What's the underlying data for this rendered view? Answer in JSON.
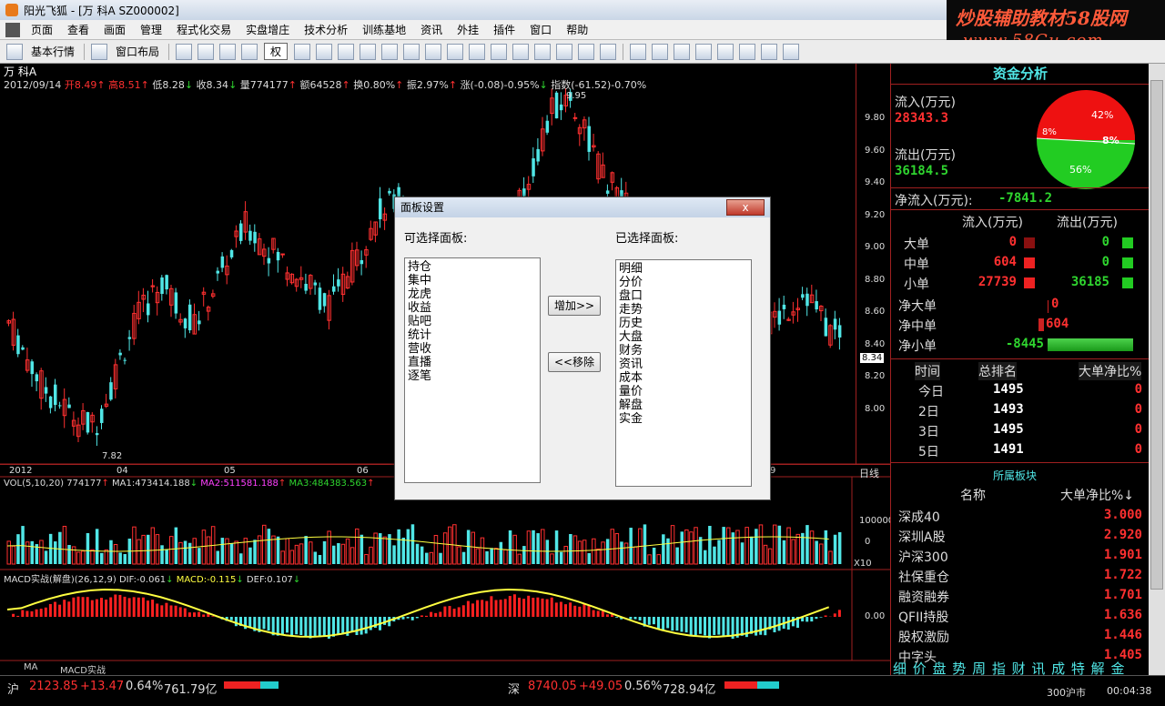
{
  "window": {
    "title": "阳光飞狐 - [万  科A  SZ000002]"
  },
  "watermark": {
    "line1": "炒股辅助教材58股网",
    "line2": "www.58Gu.com"
  },
  "menu": {
    "items": [
      "页面",
      "查看",
      "画面",
      "管理",
      "程式化交易",
      "实盘增庄",
      "技术分析",
      "训练基地",
      "资讯",
      "外挂",
      "插件",
      "窗口",
      "帮助"
    ]
  },
  "toolbar": {
    "market_label": "基本行情",
    "layout_label": "窗口布局",
    "quan_label": "权"
  },
  "kline": {
    "stock_name": "万  科A",
    "date": "2012/09/14",
    "open": "开8.49",
    "high": "高8.51",
    "low": "低8.28",
    "close": "收8.34",
    "volume": "量774177",
    "amount": "额64528",
    "turnover": "换0.80%",
    "amplitude": "振2.97%",
    "change": "涨(-0.08)-0.95%",
    "index": "指数(-61.52)-0.70%",
    "max_label": "9.95",
    "min_label": "7.82",
    "current_price_label": "8.34",
    "price_ticks": [
      "9.80",
      "9.60",
      "9.40",
      "9.20",
      "9.00",
      "8.80",
      "8.60",
      "8.40",
      "8.20",
      "8.00"
    ],
    "date_ticks": [
      "2012",
      "04",
      "05",
      "06",
      "9"
    ],
    "period_label": "日线"
  },
  "volume_panel": {
    "title": "VOL(5,10,20)",
    "value": "774177",
    "ma1": "MA1:473414.188",
    "ma2": "MA2:511581.188",
    "ma3": "MA3:484383.563",
    "axis_label": "100000",
    "axis_zero": "0",
    "unit_label": "X10"
  },
  "macd_panel": {
    "title": "MACD实战(解盘)(26,12,9)",
    "dif": "DIF:-0.061",
    "macd": "MACD:-0.115",
    "dea": "DEF:0.107",
    "axis_zero": "0.00"
  },
  "bottom_tabs": [
    "MA",
    "MACD实战"
  ],
  "capital": {
    "title": "资金分析",
    "inflow_label": "流入(万元)",
    "inflow_value": "28343.3",
    "outflow_label": "流出(万元)",
    "outflow_value": "36184.5",
    "net_label": "净流入(万元):",
    "net_value": "-7841.2",
    "pie_labels": [
      "42%",
      "8%",
      "8%",
      "56%"
    ],
    "col_in": "流入(万元)",
    "col_out": "流出(万元)",
    "rows": [
      {
        "label": "大单",
        "in": "0",
        "out": "0"
      },
      {
        "label": "中单",
        "in": "604",
        "out": "0"
      },
      {
        "label": "小单",
        "in": "27739",
        "out": "36185"
      }
    ],
    "net_rows": [
      {
        "label": "净大单",
        "value": "0"
      },
      {
        "label": "净中单",
        "value": "604"
      },
      {
        "label": "净小单",
        "value": "-8445"
      }
    ],
    "rank_header": [
      "时间",
      "总排名",
      "大单净比%"
    ],
    "rank_rows": [
      {
        "period": "今日",
        "rank": "1495",
        "ratio": "0"
      },
      {
        "period": "2日",
        "rank": "1493",
        "ratio": "0"
      },
      {
        "period": "3日",
        "rank": "1495",
        "ratio": "0"
      },
      {
        "period": "5日",
        "rank": "1491",
        "ratio": "0"
      }
    ],
    "sector_title": "所属板块",
    "sector_header": [
      "名称",
      "大单净比%↓"
    ],
    "sectors": [
      {
        "name": "深成40",
        "ratio": "3.000"
      },
      {
        "name": "深圳A股",
        "ratio": "2.920"
      },
      {
        "name": "沪深300",
        "ratio": "1.901"
      },
      {
        "name": "社保重仓",
        "ratio": "1.722"
      },
      {
        "name": "融资融券",
        "ratio": "1.701"
      },
      {
        "name": "QFII持股",
        "ratio": "1.636"
      },
      {
        "name": "股权激励",
        "ratio": "1.446"
      },
      {
        "name": "中字头",
        "ratio": "1.405"
      }
    ],
    "tab_strip": "细 价 盘 势 周 指 财 讯 成 特 解 金"
  },
  "status": {
    "sh_label": "沪",
    "sh_index": "2123.85",
    "sh_change": "+13.47",
    "sh_pct": "0.64%",
    "sh_amount": "761.79亿",
    "sz_label": "深",
    "sz_index": "8740.05",
    "sz_change": "+49.05",
    "sz_pct": "0.56%",
    "sz_amount": "728.94亿",
    "market_tag": "300沪市",
    "time": "00:04:38"
  },
  "dialog": {
    "title": "面板设置",
    "close": "x",
    "available_label": "可选择面板:",
    "selected_label": "已选择面板:",
    "available": [
      "持仓",
      "集中",
      "龙虎",
      "收益",
      "贴吧",
      "统计",
      "营收",
      "直播",
      "逐笔"
    ],
    "selected": [
      "明细",
      "分价",
      "盘口",
      "走势",
      "历史",
      "大盘",
      "财务",
      "资讯",
      "成本",
      "量价",
      "解盘",
      "实金"
    ],
    "add_button": "增加>>",
    "remove_button": "<<移除"
  },
  "colors": {
    "up": "#ff3030",
    "down": "#50e6e6",
    "frame": "#a02020"
  }
}
